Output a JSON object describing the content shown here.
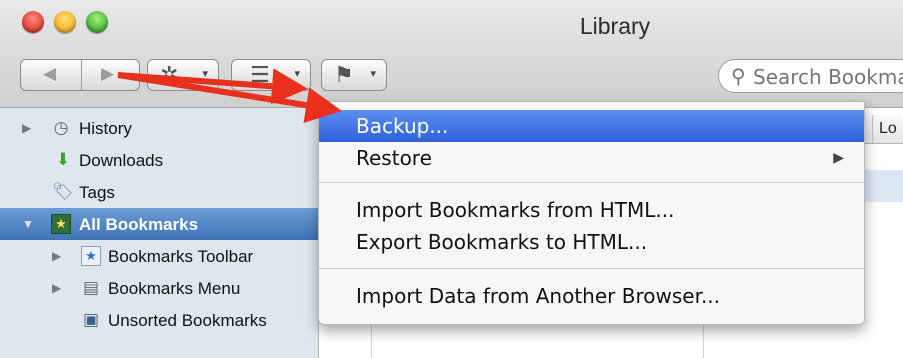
{
  "window": {
    "title": "Library"
  },
  "toolbar": {
    "back_glyph": "◀",
    "forward_glyph": "▶",
    "organize_glyph": "✲",
    "views_glyph": "☰",
    "import_glyph": "⚑",
    "dropdown_glyph": "▾",
    "search_placeholder": "Search Bookmarks"
  },
  "sidebar": {
    "items": [
      {
        "label": "History",
        "icon": "clock-icon",
        "glyph": "◷",
        "has_disclosure": true
      },
      {
        "label": "Downloads",
        "icon": "download-arrow-icon",
        "glyph": "⬇"
      },
      {
        "label": "Tags",
        "icon": "tag-icon",
        "glyph": "🏷"
      },
      {
        "label": "All Bookmarks",
        "icon": "bookmarks-star-icon",
        "glyph": "★",
        "has_disclosure": true,
        "selected": true
      },
      {
        "label": "Bookmarks Toolbar",
        "icon": "star-folder-icon",
        "glyph": "★",
        "has_disclosure": true
      },
      {
        "label": "Bookmarks Menu",
        "icon": "menu-folder-icon",
        "glyph": "▤",
        "has_disclosure": true
      },
      {
        "label": "Unsorted Bookmarks",
        "icon": "unsorted-folder-icon",
        "glyph": "▣"
      }
    ]
  },
  "content": {
    "column_location": "Lo"
  },
  "menu": {
    "items": [
      {
        "label": "Backup...",
        "highlighted": true
      },
      {
        "label": "Restore",
        "submenu_glyph": "▶"
      },
      {
        "label": "Import Bookmarks from HTML..."
      },
      {
        "label": "Export Bookmarks to HTML..."
      },
      {
        "label": "Import Data from Another Browser..."
      }
    ]
  },
  "colors": {
    "annotation_arrow": "#e8301c",
    "menu_highlight": "#3d6fe3",
    "sidebar_selected": "#4a7fc1",
    "sidebar_bg": "#dfe6ee"
  }
}
